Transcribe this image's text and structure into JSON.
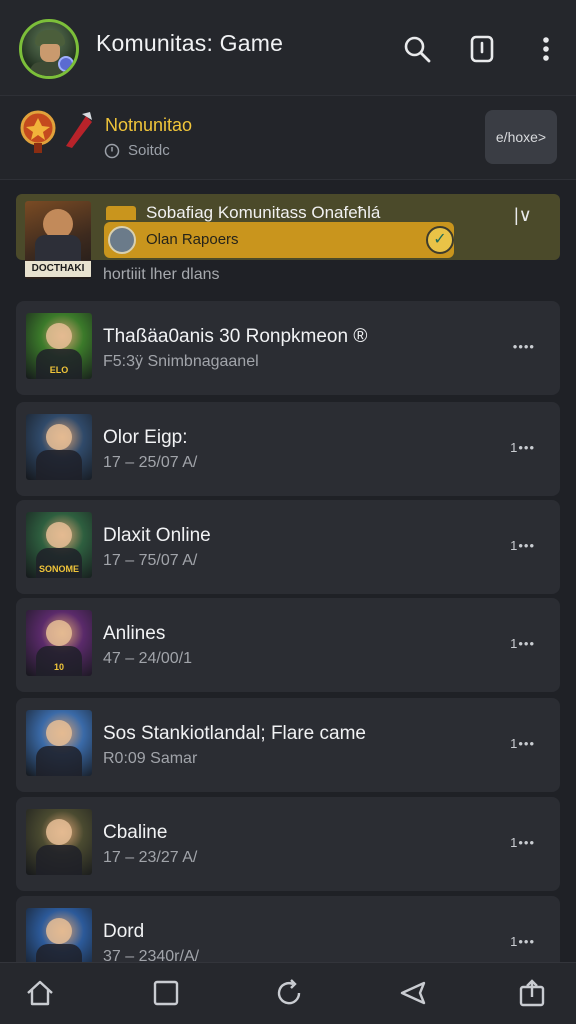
{
  "header": {
    "title": "Komunitas: Game",
    "icons": [
      "search-icon",
      "phone-icon",
      "more-vertical-icon"
    ]
  },
  "section": {
    "title": "Notnunitao",
    "subtitle": "Soitdc",
    "subtitle_icon": "clock-icon",
    "action_label": "e/hoxe>"
  },
  "featured": {
    "badge_text": "DOCTHAKI",
    "title": "Sobafiag Komunitass Onafeħlá",
    "pill_label": "Olan Rapoers",
    "subtitle": "hortiiit lher dlans",
    "chevron": "|∨"
  },
  "items": [
    {
      "title": "Thaßäa0anis 30 Ronpkmeon ®",
      "subtitle": "F5:3ÿ Snimbnagaanel",
      "more": "••••",
      "thumb_color": "#3b7a2a",
      "thumb_label": "ELO"
    },
    {
      "title": "Olor Eiɡp:",
      "subtitle": "17 – 25/07 A/",
      "more": "1•••",
      "thumb_color": "#304a6a",
      "thumb_label": ""
    },
    {
      "title": "Dlaxit Online",
      "subtitle": "17 – 75/07 A/",
      "more": "1•••",
      "thumb_color": "#2e5f3f",
      "thumb_label": "SONOME"
    },
    {
      "title": "Anlines",
      "subtitle": "47 – 24/00/1",
      "more": "1•••",
      "thumb_color": "#5a2a6a",
      "thumb_label": "10"
    },
    {
      "title": "Sos Stankiotlandal; Flare came",
      "subtitle": "R0:09 Samar",
      "more": "1•••",
      "thumb_color": "#3a6aa8",
      "thumb_label": ""
    },
    {
      "title": "Cbaline",
      "subtitle": "17 – 23/27 A/",
      "more": "1•••",
      "thumb_color": "#4a4a30",
      "thumb_label": ""
    },
    {
      "title": "Dord",
      "subtitle": "37 – 2340r/A/",
      "more": "1•••",
      "thumb_color": "#2c5a9a",
      "thumb_label": ""
    }
  ],
  "bottom_nav": [
    "home-icon",
    "square-icon",
    "refresh-icon",
    "announce-icon",
    "share-icon"
  ]
}
